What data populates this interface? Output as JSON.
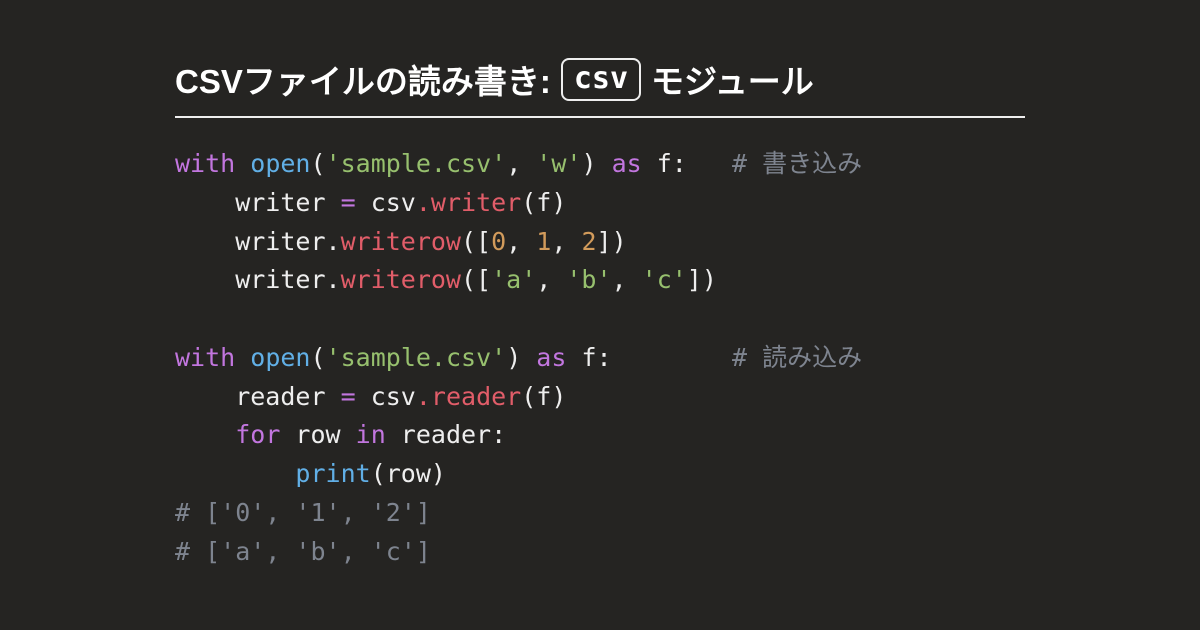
{
  "title": {
    "pre": "CSVファイルの読み書き:",
    "badge": "csv",
    "post": "モジュール"
  },
  "code": [
    [
      {
        "t": "with",
        "c": "kw"
      },
      {
        "t": " ",
        "c": "punc"
      },
      {
        "t": "open",
        "c": "fn"
      },
      {
        "t": "(",
        "c": "punc"
      },
      {
        "t": "'sample.csv'",
        "c": "str"
      },
      {
        "t": ", ",
        "c": "punc"
      },
      {
        "t": "'w'",
        "c": "str"
      },
      {
        "t": ") ",
        "c": "punc"
      },
      {
        "t": "as",
        "c": "kw"
      },
      {
        "t": " f:   ",
        "c": "punc"
      },
      {
        "t": "# 書き込み",
        "c": "cmt"
      }
    ],
    [
      {
        "t": "    writer ",
        "c": "punc"
      },
      {
        "t": "=",
        "c": "kw"
      },
      {
        "t": " csv",
        "c": "punc"
      },
      {
        "t": ".",
        "c": "name"
      },
      {
        "t": "writer",
        "c": "name"
      },
      {
        "t": "(f)",
        "c": "punc"
      }
    ],
    [
      {
        "t": "    writer.",
        "c": "punc"
      },
      {
        "t": "writerow",
        "c": "name"
      },
      {
        "t": "([",
        "c": "punc"
      },
      {
        "t": "0",
        "c": "num"
      },
      {
        "t": ", ",
        "c": "punc"
      },
      {
        "t": "1",
        "c": "num"
      },
      {
        "t": ", ",
        "c": "punc"
      },
      {
        "t": "2",
        "c": "num"
      },
      {
        "t": "])",
        "c": "punc"
      }
    ],
    [
      {
        "t": "    writer.",
        "c": "punc"
      },
      {
        "t": "writerow",
        "c": "name"
      },
      {
        "t": "([",
        "c": "punc"
      },
      {
        "t": "'a'",
        "c": "str"
      },
      {
        "t": ", ",
        "c": "punc"
      },
      {
        "t": "'b'",
        "c": "str"
      },
      {
        "t": ", ",
        "c": "punc"
      },
      {
        "t": "'c'",
        "c": "str"
      },
      {
        "t": "])",
        "c": "punc"
      }
    ],
    [],
    [
      {
        "t": "with",
        "c": "kw"
      },
      {
        "t": " ",
        "c": "punc"
      },
      {
        "t": "open",
        "c": "fn"
      },
      {
        "t": "(",
        "c": "punc"
      },
      {
        "t": "'sample.csv'",
        "c": "str"
      },
      {
        "t": ") ",
        "c": "punc"
      },
      {
        "t": "as",
        "c": "kw"
      },
      {
        "t": " f:        ",
        "c": "punc"
      },
      {
        "t": "# 読み込み",
        "c": "cmt"
      }
    ],
    [
      {
        "t": "    reader ",
        "c": "punc"
      },
      {
        "t": "=",
        "c": "kw"
      },
      {
        "t": " csv",
        "c": "punc"
      },
      {
        "t": ".",
        "c": "name"
      },
      {
        "t": "reader",
        "c": "name"
      },
      {
        "t": "(f)",
        "c": "punc"
      }
    ],
    [
      {
        "t": "    ",
        "c": "punc"
      },
      {
        "t": "for",
        "c": "kw"
      },
      {
        "t": " row ",
        "c": "punc"
      },
      {
        "t": "in",
        "c": "kw"
      },
      {
        "t": " reader:",
        "c": "punc"
      }
    ],
    [
      {
        "t": "        ",
        "c": "punc"
      },
      {
        "t": "print",
        "c": "fn"
      },
      {
        "t": "(row)",
        "c": "punc"
      }
    ],
    [
      {
        "t": "# ['0', '1', '2']",
        "c": "cmt"
      }
    ],
    [
      {
        "t": "# ['a', 'b', 'c']",
        "c": "cmt"
      }
    ]
  ]
}
